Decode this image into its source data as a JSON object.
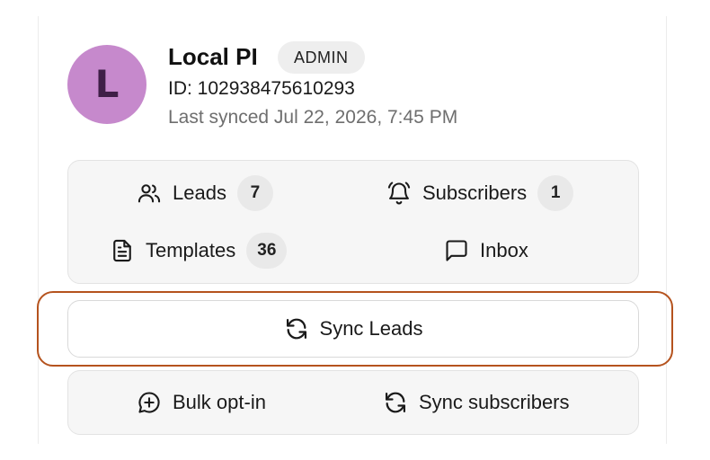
{
  "account": {
    "avatar_letter": "L",
    "name": "Local PI",
    "role": "ADMIN",
    "id_text": "ID: 102938475610293",
    "last_synced": "Last synced Jul 22, 2026, 7:45 PM"
  },
  "stats": {
    "leads": {
      "label": "Leads",
      "count": "7",
      "icon": "users-icon"
    },
    "subscribers": {
      "label": "Subscribers",
      "count": "1",
      "icon": "bell-icon"
    },
    "templates": {
      "label": "Templates",
      "count": "36",
      "icon": "file-text-icon"
    },
    "inbox": {
      "label": "Inbox",
      "icon": "message-square-icon"
    }
  },
  "sync_leads": {
    "label": "Sync Leads",
    "icon": "refresh-icon"
  },
  "actions": {
    "bulk_opt_in": {
      "label": "Bulk opt-in",
      "icon": "message-plus-icon"
    },
    "sync_subscribers": {
      "label": "Sync subscribers",
      "icon": "refresh-icon"
    }
  },
  "colors": {
    "avatar_bg": "#c689cc",
    "avatar_text": "#3f1f47",
    "focus_ring": "#b5531e"
  }
}
